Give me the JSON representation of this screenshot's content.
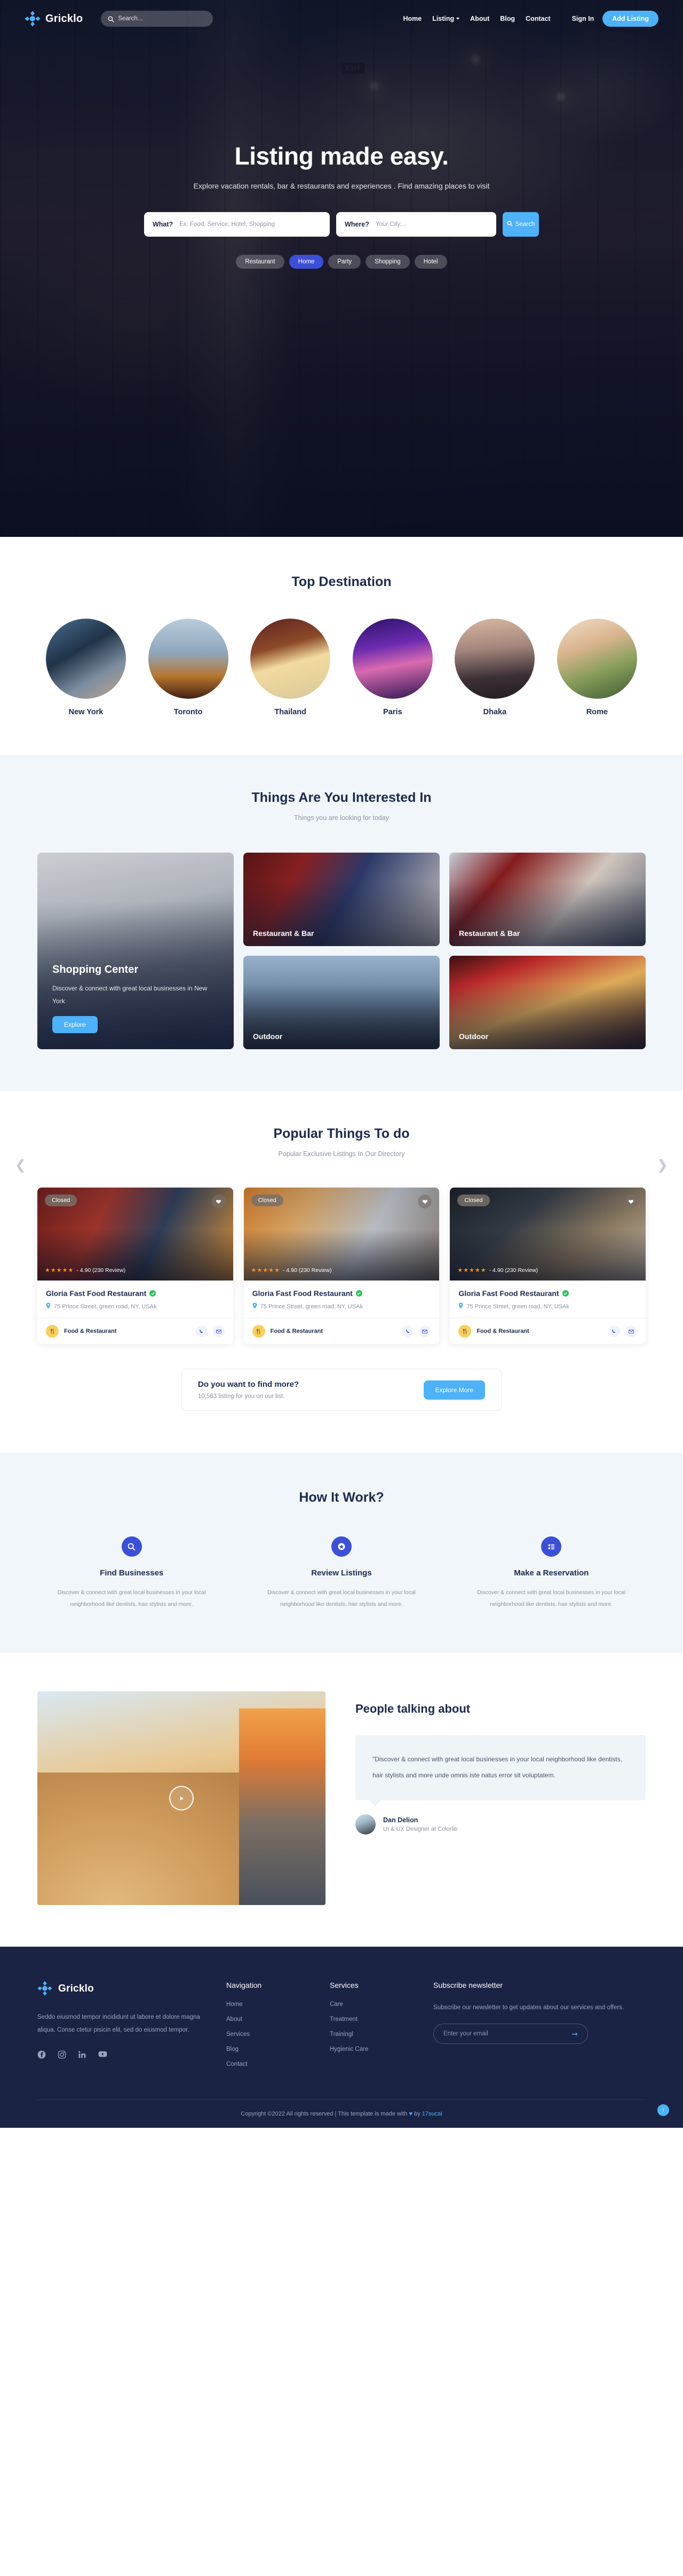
{
  "brand": {
    "name": "Gricklo",
    "logo_icon": "diamond-cluster-icon"
  },
  "nav": {
    "search_placeholder": "Search...",
    "search_icon": "search-icon",
    "links": [
      {
        "label": "Home",
        "has_caret": false
      },
      {
        "label": "Listing",
        "has_caret": true
      },
      {
        "label": "About",
        "has_caret": false
      },
      {
        "label": "Blog",
        "has_caret": false
      },
      {
        "label": "Contact",
        "has_caret": false
      }
    ],
    "sign_in": "Sign In",
    "add_listing": "Add Listing"
  },
  "hero": {
    "title": "Listing made easy.",
    "subtitle": "Explore vacation rentals, bar & restaurants and experiences . Find amazing places to visit",
    "what_label": "What?",
    "what_placeholder": "Ex: Food, Service, Hotel, Shopping",
    "where_label": "Where?",
    "where_placeholder": "Your City....",
    "search_button": "Search",
    "search_icon": "search-icon",
    "pills": [
      {
        "label": "Restaurant",
        "active": false
      },
      {
        "label": "Home",
        "active": true
      },
      {
        "label": "Party",
        "active": false
      },
      {
        "label": "Shopping",
        "active": false
      },
      {
        "label": "Hotel",
        "active": false
      }
    ]
  },
  "destinations": {
    "title": "Top Destination",
    "items": [
      {
        "name": "New York"
      },
      {
        "name": "Toronto"
      },
      {
        "name": "Thailand"
      },
      {
        "name": "Paris"
      },
      {
        "name": "Dhaka"
      },
      {
        "name": "Rome"
      }
    ]
  },
  "interested": {
    "title": "Things Are You Interested In",
    "subtitle": "Things you are looking for today",
    "cards": [
      {
        "label": "Restaurant & Bar"
      },
      {
        "label": "Outdoor"
      },
      {
        "label": "Restaurant & Bar"
      },
      {
        "label": "Outdoor"
      }
    ],
    "feature": {
      "title": "Shopping Center",
      "text": "Discover & connect with great local businesses in New York",
      "button": "Explore"
    }
  },
  "popular": {
    "title": "Popular Things To do",
    "subtitle": "Popular Exclusive Listings In Our Directory",
    "prev_icon": "chevron-left-icon",
    "next_icon": "chevron-right-icon",
    "listings": [
      {
        "status": "Closed",
        "stars": "★★★★★",
        "rating_text": "- 4.90 (230 Review)",
        "name": "Gloria Fast Food Restaurant",
        "address": "75 Prince Street, green road, NY, USAk",
        "category": "Food & Restaurant",
        "verified": true
      },
      {
        "status": "Closed",
        "stars": "★★★★★",
        "rating_text": "- 4.90 (230 Review)",
        "name": "Gloria Fast Food Restaurant",
        "address": "75 Prince Street, green road, NY, USAk",
        "category": "Food & Restaurant",
        "verified": true
      },
      {
        "status": "Closed",
        "stars": "★★★★★",
        "rating_text": "- 4.90 (230 Review)",
        "name": "Gloria Fast Food Restaurant",
        "address": "75 Prince Street, green road, NY, USAk",
        "category": "Food & Restaurant",
        "verified": true
      }
    ],
    "find_more": {
      "title": "Do you want to find more?",
      "text": "10,563 listing for you on our list.",
      "button": "Explore More"
    }
  },
  "howitwork": {
    "title": "How It Work?",
    "steps": [
      {
        "icon": "search-icon",
        "title": "Find Businesses",
        "text": "Discover & connect with great local businesses in your local neighborhood like dentists, hair stylists and more."
      },
      {
        "icon": "star-badge-icon",
        "title": "Review Listings",
        "text": "Discover & connect with great local businesses in your local neighborhood like dentists, hair stylists and more."
      },
      {
        "icon": "list-icon",
        "title": "Make a Reservation",
        "text": "Discover & connect with great local businesses in your local neighborhood like dentists, hair stylists and more."
      }
    ]
  },
  "testimonial": {
    "title": "People talking about",
    "play_icon": "play-icon",
    "quote": "\"Discover & connect with great local businesses in your local neighborhood like dentists, hair stylists and more unde omnis iste natus error sit voluptatem.",
    "author_name": "Dan Delion",
    "author_role": "UI & UX Designer at Colorlib"
  },
  "footer": {
    "about": "Seddo eiusmod tempor incididunt ut labore et dolore magna aliqua. Conse ctetur pisicin elit, sed do eiusmod tempor.",
    "socials": [
      {
        "name": "facebook-icon"
      },
      {
        "name": "instagram-icon"
      },
      {
        "name": "linkedin-icon"
      },
      {
        "name": "youtube-icon"
      }
    ],
    "columns": [
      {
        "head": "Navigation",
        "links": [
          "Home",
          "About",
          "Services",
          "Blog",
          "Contact"
        ]
      },
      {
        "head": "Services",
        "links": [
          "Care",
          "Treatment",
          "Trainingl",
          "Hygienic Care"
        ]
      }
    ],
    "newsletter": {
      "head": "Subscribe newsletter",
      "text": "Subscribe our newsletter to get updates about our services and offers.",
      "placeholder": "Enter your email",
      "submit_icon": "arrow-right-icon"
    },
    "copyright_pre": "Copyright ©2022 All rights reserved | This template is made with ",
    "copyright_heart": "♥",
    "copyright_mid": " by ",
    "copyright_link": "17sucai",
    "to_top_icon": "arrow-up-icon"
  },
  "colors": {
    "accent_blue": "#4db2f7",
    "deep_blue": "#3b4fd8",
    "navy": "#1b2345",
    "light_bg": "#f1f6fa",
    "star_orange": "#f7941e",
    "verified_green": "#2ec25f",
    "category_yellow": "#fbcf5d"
  }
}
